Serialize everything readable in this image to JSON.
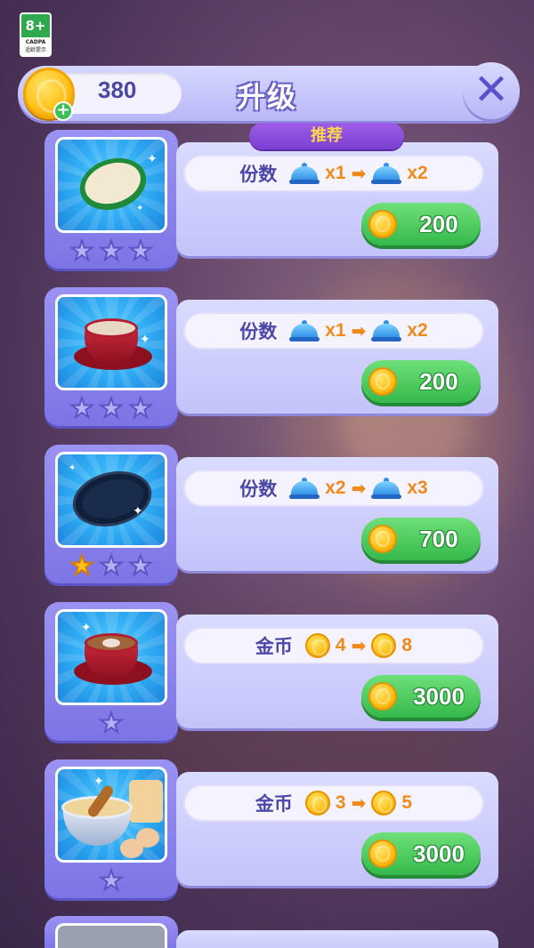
{
  "age_rating": {
    "value": "8+",
    "org": "CADPA",
    "tip": "适龄提示"
  },
  "header": {
    "coins": "380",
    "title": "升级",
    "close_symbol": "✕"
  },
  "recommend_label": "推荐",
  "items": [
    {
      "name": "plate-green",
      "stars": [
        false,
        false,
        false
      ],
      "effect_label": "份数",
      "icon": "cloche-icon",
      "from": "x1",
      "to": "x2",
      "price": "200"
    },
    {
      "name": "coffee-cup",
      "stars": [
        false,
        false,
        false
      ],
      "effect_label": "份数",
      "icon": "cloche-icon",
      "from": "x1",
      "to": "x2",
      "price": "200"
    },
    {
      "name": "black-plate",
      "stars": [
        true,
        false,
        false
      ],
      "effect_label": "份数",
      "icon": "cloche-icon",
      "from": "x2",
      "to": "x3",
      "price": "700"
    },
    {
      "name": "latte-cup",
      "stars": [
        false
      ],
      "effect_label": "金币",
      "icon": "coin-icon",
      "from": "4",
      "to": "8",
      "price": "3000"
    },
    {
      "name": "batter-bowl",
      "stars": [
        false
      ],
      "effect_label": "金币",
      "icon": "coin-icon",
      "from": "3",
      "to": "5",
      "price": "3000"
    }
  ],
  "colors": {
    "accent": "#6b63c8",
    "buy_button": "#35b94a",
    "recommend": "#7b3fd2",
    "coin": "#ffc21a"
  }
}
